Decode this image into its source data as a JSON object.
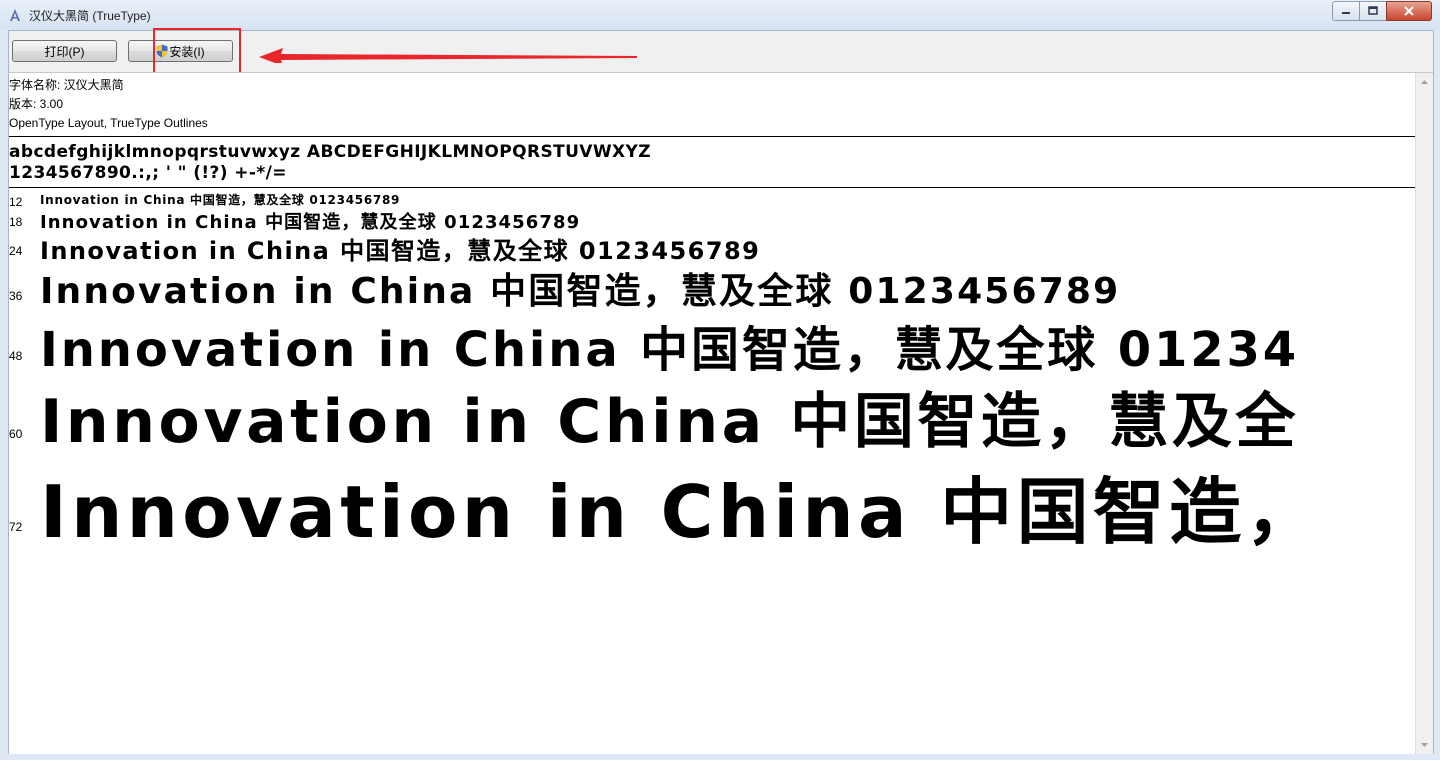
{
  "window": {
    "title": "汉仪大黑简 (TrueType)",
    "app_icon": "font-icon",
    "controls": [
      "minimize-icon",
      "maximize-icon",
      "close-icon"
    ]
  },
  "toolbar": {
    "print_label": "打印(P)",
    "install_label": "安装(I)",
    "install_icon": "uac-shield-icon"
  },
  "annotation": {
    "highlight_color": "#e8262b",
    "arrow_color": "#e8262b"
  },
  "font_info": {
    "name_line": "字体名称: 汉仪大黑简",
    "version_line": "版本: 3.00",
    "type_line": "OpenType Layout, TrueType Outlines"
  },
  "charset": {
    "line1": "abcdefghijklmnopqrstuvwxyz ABCDEFGHIJKLMNOPQRSTUVWXYZ",
    "line2": "1234567890.:,; ' \" (!?) +-*/="
  },
  "samples": [
    {
      "size": "12",
      "text": "Innovation in China 中国智造，慧及全球 0123456789"
    },
    {
      "size": "18",
      "text": "Innovation in China 中国智造，慧及全球 0123456789"
    },
    {
      "size": "24",
      "text": "Innovation in China 中国智造，慧及全球 0123456789"
    },
    {
      "size": "36",
      "text": "Innovation in China 中国智造，慧及全球 0123456789"
    },
    {
      "size": "48",
      "text": "Innovation in China 中国智造，慧及全球 01234"
    },
    {
      "size": "60",
      "text": "Innovation in China 中国智造，慧及全"
    },
    {
      "size": "72",
      "text": "Innovation in China 中国智造，"
    }
  ]
}
